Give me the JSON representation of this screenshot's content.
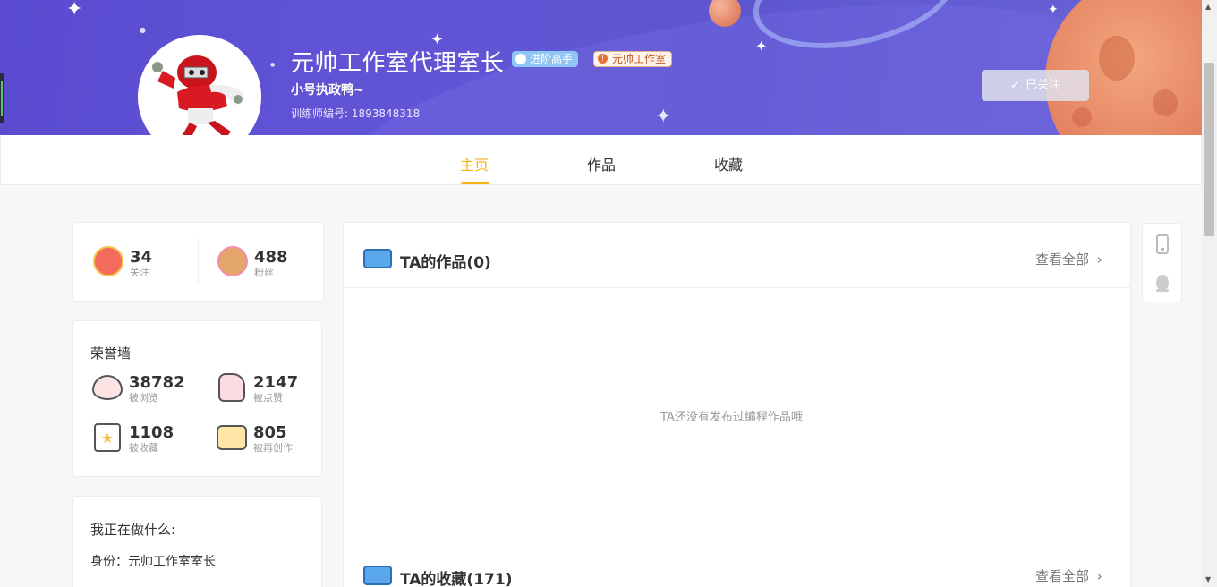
{
  "profile": {
    "name": "元帅工作室代理室长",
    "signature": "小号执政鸭~",
    "trainer_id": "训练师编号: 1893848318",
    "badges": {
      "advanced": "进阶高手",
      "studio": "元帅工作室"
    },
    "follow_button": "已关注"
  },
  "tabs": [
    {
      "label": "主页",
      "active": true
    },
    {
      "label": "作品",
      "active": false
    },
    {
      "label": "收藏",
      "active": false
    }
  ],
  "follow_stats": {
    "following": {
      "value": "34",
      "label": "关注"
    },
    "fans": {
      "value": "488",
      "label": "粉丝"
    }
  },
  "honor": {
    "title": "荣誉墙",
    "items": [
      {
        "value": "38782",
        "label": "被浏览",
        "icon": "eye-icon"
      },
      {
        "value": "2147",
        "label": "被点赞",
        "icon": "thumbs-up-icon"
      },
      {
        "value": "1108",
        "label": "被收藏",
        "icon": "star-box-icon"
      },
      {
        "value": "805",
        "label": "被再创作",
        "icon": "recreate-icon"
      }
    ]
  },
  "doing": {
    "title": "我正在做什么:",
    "identity": "身份：元帅工作室室长"
  },
  "works": {
    "title": "TA的作品(0)",
    "see_all": "查看全部",
    "empty": "TA还没有发布过编程作品哦"
  },
  "favorites": {
    "title": "TA的收藏(171)",
    "see_all": "查看全部"
  },
  "colors": {
    "accent": "#f5b315",
    "banner": "#5a4bd0"
  }
}
